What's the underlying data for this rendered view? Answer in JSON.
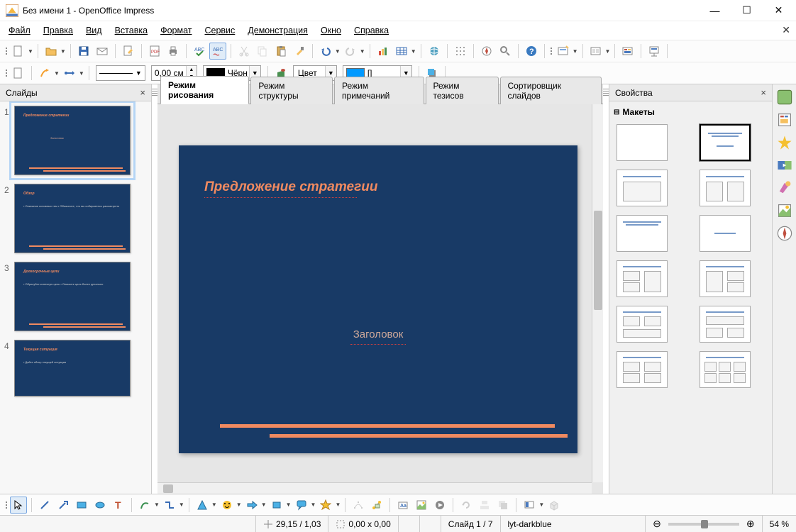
{
  "window": {
    "title": "Без имени 1 - OpenOffice Impress"
  },
  "menu": [
    "Файл",
    "Правка",
    "Вид",
    "Вставка",
    "Формат",
    "Сервис",
    "Демонстрация",
    "Окно",
    "Справка"
  ],
  "toolbar2": {
    "line_width": "0,00 см",
    "line_color_label": "Чёрн",
    "fill_type": "Цвет",
    "fill_swatch_label": "[]"
  },
  "panels": {
    "slides_title": "Слайды",
    "properties_title": "Свойства",
    "layouts_title": "Макеты"
  },
  "view_tabs": [
    "Режим рисования",
    "Режим структуры",
    "Режим примечаний",
    "Режим тезисов",
    "Сортировщик слайдов"
  ],
  "slide_canvas": {
    "title": "Предложение стратегии",
    "subtitle": "Заголовок"
  },
  "thumbs": [
    {
      "num": "1",
      "title": "Предложение стратегии",
      "sub": "Заголовок",
      "body": ""
    },
    {
      "num": "2",
      "title": "Обзор",
      "sub": "",
      "body": "• Описание основных тем\n• Объясните, что вы собираетесь рассмотреть"
    },
    {
      "num": "3",
      "title": "Долгосрочные цели",
      "sub": "",
      "body": "• Обрисуйте конечную цель\n• Опишите цель более детально"
    },
    {
      "num": "4",
      "title": "Текущая ситуация",
      "sub": "",
      "body": "• Дайте обзор текущей ситуации"
    }
  ],
  "status": {
    "pos": "29,15 / 1,03",
    "size": "0,00 x 0,00",
    "slide": "Слайд 1 / 7",
    "layout": "lyt-darkblue",
    "zoom": "54 %"
  },
  "chart_data": null
}
